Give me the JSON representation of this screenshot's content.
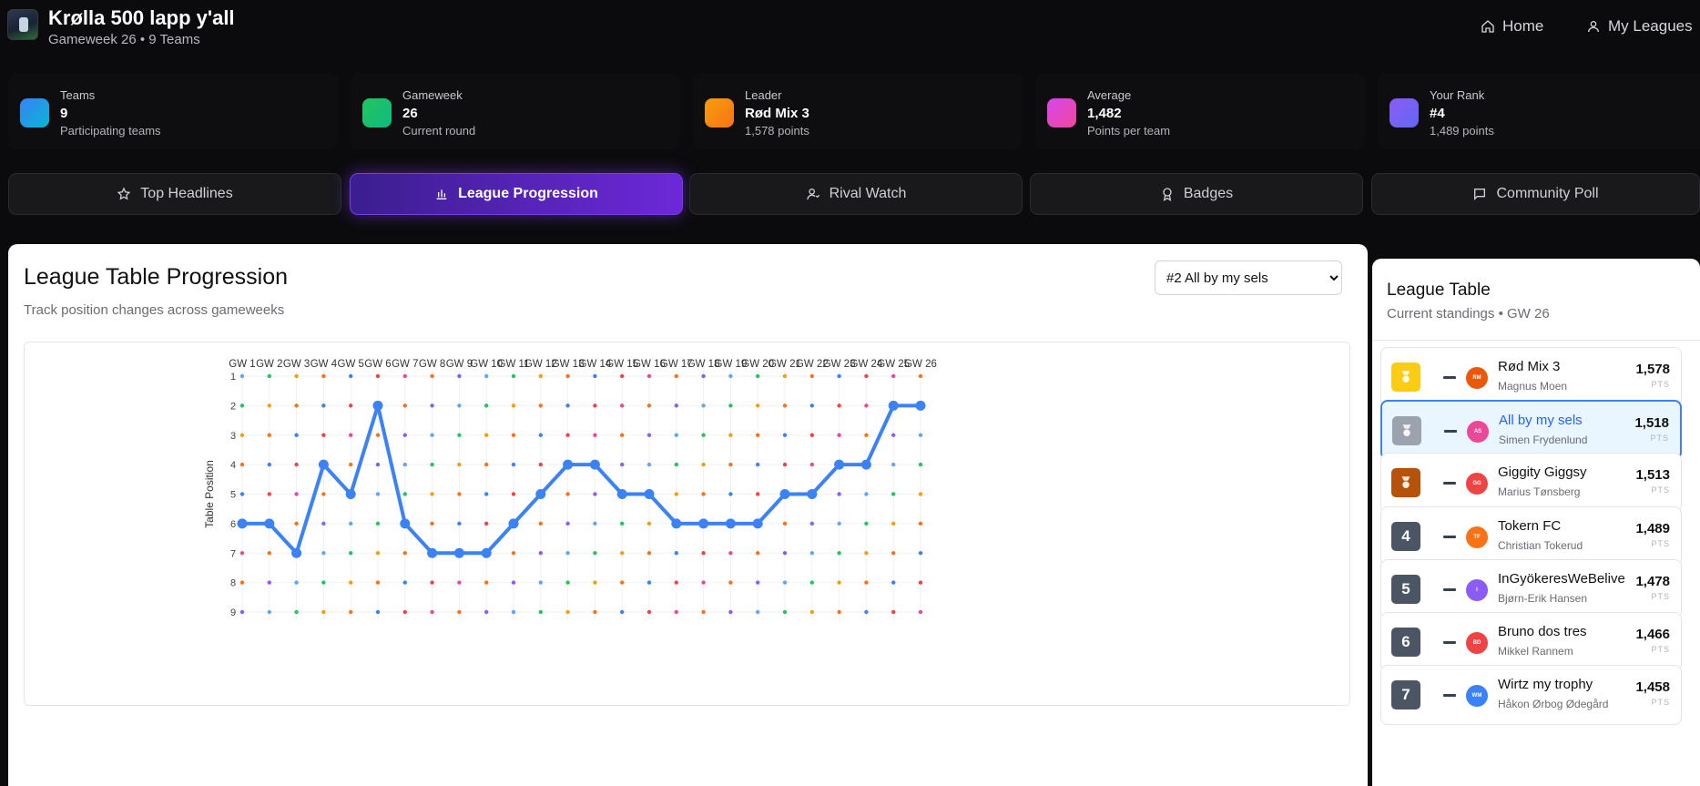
{
  "app": {
    "title": "Krølla 500 lapp y'all",
    "subtitle": "Gameweek 26 • 9 Teams"
  },
  "nav": {
    "home": "Home",
    "my_leagues": "My Leagues"
  },
  "stats": [
    {
      "label": "Teams",
      "value": "9",
      "desc": "Participating teams",
      "color": "#3b82f6"
    },
    {
      "label": "Gameweek",
      "value": "26",
      "desc": "Current round",
      "color": "#22c55e"
    },
    {
      "label": "Leader",
      "value": "Rød Mix 3",
      "desc": "1,578 points",
      "color": "#f59e0b"
    },
    {
      "label": "Average",
      "value": "1,482",
      "desc": "Points per team",
      "color": "#d946ef"
    },
    {
      "label": "Your Rank",
      "value": "#4",
      "desc": "1,489 points",
      "color": "#8b5cf6"
    }
  ],
  "tabs": [
    {
      "label": "Top Headlines",
      "icon": "star-icon"
    },
    {
      "label": "League Progression",
      "icon": "bar-chart-icon"
    },
    {
      "label": "Rival Watch",
      "icon": "user-icon"
    },
    {
      "label": "Badges",
      "icon": "award-icon"
    },
    {
      "label": "Community Poll",
      "icon": "message-icon"
    }
  ],
  "main": {
    "title": "League Table Progression",
    "subtitle": "Track position changes across gameweeks",
    "selected_team": "#2 All by my sels"
  },
  "chart_data": {
    "type": "line",
    "ylabel": "Table Position",
    "x": [
      "GW 1",
      "GW 2",
      "GW 3",
      "GW 4",
      "GW 5",
      "GW 6",
      "GW 7",
      "GW 8",
      "GW 9",
      "GW 10",
      "GW 11",
      "GW 12",
      "GW 13",
      "GW 14",
      "GW 15",
      "GW 16",
      "GW 17",
      "GW 18",
      "GW 19",
      "GW 20",
      "GW 21",
      "GW 22",
      "GW 23",
      "GW 24",
      "GW 25",
      "GW 26"
    ],
    "y_ticks": [
      1,
      2,
      3,
      4,
      5,
      6,
      7,
      8,
      9
    ],
    "ylim": [
      1,
      9
    ],
    "y_inverted": true,
    "series": [
      {
        "values": [
          6,
          6,
          7,
          4,
          5,
          2,
          6,
          7,
          7,
          7,
          6,
          5,
          4,
          4,
          5,
          5,
          6,
          6,
          6,
          6,
          5,
          5,
          4,
          4,
          2,
          2
        ],
        "color": "#3b82f6"
      }
    ],
    "grid_dot_colors": [
      "#60a5fa",
      "#22c55e",
      "#f59e0b",
      "#f97316",
      "#3b82f6",
      "#ef4444",
      "#ec4899",
      "#f97316",
      "#8b5cf6"
    ]
  },
  "league_table": {
    "title": "League Table",
    "subtitle": "Current standings • GW 26",
    "pts_label": "PTS",
    "rows": [
      {
        "rank": "1",
        "name": "Rød Mix 3",
        "manager": "Magnus Moen",
        "points": "1,578",
        "initials": "RM",
        "rank_color": "#facc15",
        "avatar_color": "#ea580c"
      },
      {
        "rank": "2",
        "name": "All by my sels",
        "manager": "Simen Frydenlund",
        "points": "1,518",
        "initials": "AS",
        "rank_color": "#9ca3af",
        "avatar_color": "#ec4899"
      },
      {
        "rank": "3",
        "name": "Giggity Giggsy",
        "manager": "Marius Tønsberg",
        "points": "1,513",
        "initials": "GG",
        "rank_color": "#b45309",
        "avatar_color": "#ef4444"
      },
      {
        "rank": "4",
        "name": "Tokern FC",
        "manager": "Christian Tokerud",
        "points": "1,489",
        "initials": "TF",
        "rank_color": "#4b5563",
        "avatar_color": "#f97316"
      },
      {
        "rank": "5",
        "name": "InGyökeresWeBelive",
        "manager": "Bjørn-Erik Hansen",
        "points": "1,478",
        "initials": "I",
        "rank_color": "#4b5563",
        "avatar_color": "#8b5cf6"
      },
      {
        "rank": "6",
        "name": "Bruno dos tres",
        "manager": "Mikkel Rannem",
        "points": "1,466",
        "initials": "BD",
        "rank_color": "#4b5563",
        "avatar_color": "#ef4444"
      },
      {
        "rank": "7",
        "name": "Wirtz my trophy",
        "manager": "Håkon Ørbog Ødegård",
        "points": "1,458",
        "initials": "WM",
        "rank_color": "#4b5563",
        "avatar_color": "#3b82f6"
      }
    ]
  }
}
